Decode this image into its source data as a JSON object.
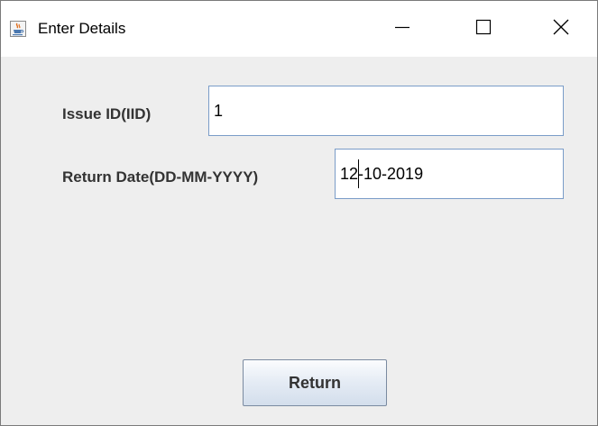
{
  "window": {
    "title": "Enter Details",
    "icon": "java-cup-icon",
    "controls": {
      "minimize": "minimize-icon",
      "maximize": "maximize-icon",
      "close": "close-icon"
    }
  },
  "form": {
    "issue_id_label": "Issue ID(IID)",
    "issue_id_value": "1",
    "return_date_label": "Return Date(DD-MM-YYYY)",
    "return_date_value": "12-10-2019"
  },
  "actions": {
    "return_label": "Return"
  },
  "colors": {
    "window_background": "#eeeeee",
    "titlebar_background": "#ffffff",
    "field_border": "#7a9cc8",
    "label_text": "#333333"
  }
}
